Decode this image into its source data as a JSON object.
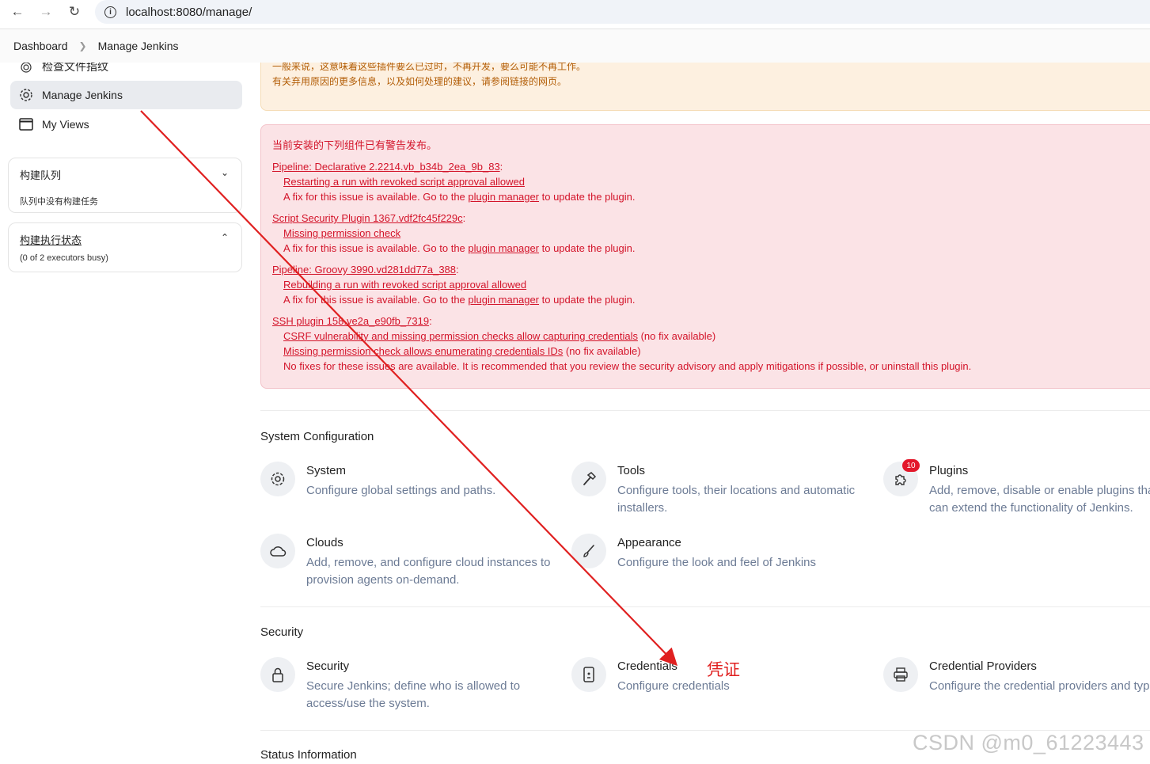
{
  "browser": {
    "url": "localhost:8080/manage/"
  },
  "breadcrumb": {
    "items": [
      "Dashboard",
      "Manage Jenkins"
    ]
  },
  "sidebar": {
    "items": [
      {
        "label": "检查文件指纹",
        "icon": "fingerprint-icon"
      },
      {
        "label": "Manage Jenkins",
        "icon": "gear-icon",
        "active": true
      },
      {
        "label": "My Views",
        "icon": "window-icon"
      }
    ],
    "queue": {
      "title": "构建队列",
      "body": "队列中没有构建任务"
    },
    "executors": {
      "title": "构建执行状态",
      "body": "(0 of 2 executors busy)"
    }
  },
  "warning": {
    "line1": "一般来说，这意味着这些插件要么已过时，不再开发，要么可能不再工作。",
    "line2": "有关弃用原因的更多信息，以及如何处理的建议，请参阅链接的网页。"
  },
  "alert": {
    "intro": "当前安装的下列组件已有警告发布。",
    "fix_prefix": "A fix for this issue is available. Go to the ",
    "fix_link": "plugin manager",
    "fix_suffix": " to update the plugin.",
    "groups": [
      {
        "plugin": "Pipeline: Declarative 2.2214.vb_b34b_2ea_9b_83",
        "issues": [
          "Restarting a run with revoked script approval allowed"
        ]
      },
      {
        "plugin": "Script Security Plugin 1367.vdf2fc45f229c",
        "issues": [
          "Missing permission check"
        ]
      },
      {
        "plugin": "Pipeline: Groovy 3990.vd281dd77a_388",
        "issues": [
          "Rebuilding a run with revoked script approval allowed"
        ]
      },
      {
        "plugin": "SSH plugin 158.ve2a_e90fb_7319",
        "issues": [
          "CSRF vulnerability and missing permission checks allow capturing credentials",
          "Missing permission check allows enumerating credentials IDs"
        ]
      }
    ],
    "no_fix": " (no fix available)",
    "ssh_note": "No fixes for these issues are available. It is recommended that you review the security advisory and apply mitigations if possible, or uninstall this plugin.",
    "colon": ":"
  },
  "sections": {
    "system_config": {
      "title": "System Configuration",
      "tiles": [
        {
          "title": "System",
          "desc": "Configure global settings and paths.",
          "icon": "gear-icon"
        },
        {
          "title": "Tools",
          "desc": "Configure tools, their locations and automatic installers.",
          "icon": "hammer-icon"
        },
        {
          "title": "Plugins",
          "desc": "Add, remove, disable or enable plugins that can extend the functionality of Jenkins.",
          "icon": "puzzle-icon",
          "badge": "10"
        },
        {
          "title": "Clouds",
          "desc": "Add, remove, and configure cloud instances to provision agents on-demand.",
          "icon": "cloud-icon"
        },
        {
          "title": "Appearance",
          "desc": "Configure the look and feel of Jenkins",
          "icon": "brush-icon"
        }
      ]
    },
    "security": {
      "title": "Security",
      "tiles": [
        {
          "title": "Security",
          "desc": "Secure Jenkins; define who is allowed to access/use the system.",
          "icon": "lock-icon"
        },
        {
          "title": "Credentials",
          "desc": "Configure credentials",
          "icon": "phone-card-icon"
        },
        {
          "title": "Credential Providers",
          "desc": "Configure the credential providers and types",
          "icon": "printer-icon"
        }
      ]
    },
    "status_info": {
      "title": "Status Information"
    }
  },
  "annotation": {
    "text": "凭证",
    "color": "#e02020"
  },
  "watermark": {
    "text": "CSDN @m0_61223443"
  }
}
